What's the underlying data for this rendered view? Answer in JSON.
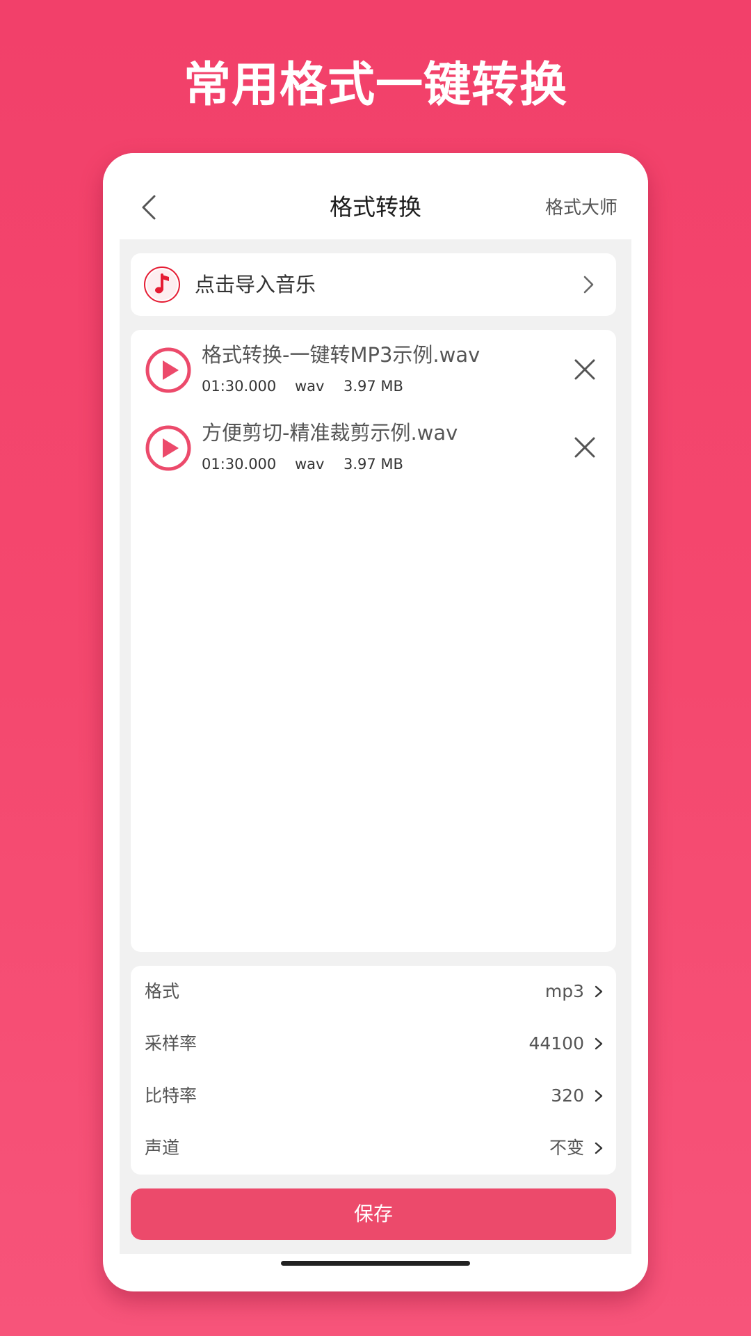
{
  "promo": {
    "title": "常用格式一键转换"
  },
  "navbar": {
    "title": "格式转换",
    "right_label": "格式大师"
  },
  "import": {
    "label": "点击导入音乐"
  },
  "files": [
    {
      "name": "格式转换-一键转MP3示例.wav",
      "duration": "01:30.000",
      "format": "wav",
      "size": "3.97 MB"
    },
    {
      "name": "方便剪切-精准裁剪示例.wav",
      "duration": "01:30.000",
      "format": "wav",
      "size": "3.97 MB"
    }
  ],
  "settings": [
    {
      "label": "格式",
      "value": "mp3"
    },
    {
      "label": "采样率",
      "value": "44100"
    },
    {
      "label": "比特率",
      "value": "320"
    },
    {
      "label": "声道",
      "value": "不变"
    }
  ],
  "actions": {
    "save_label": "保存"
  },
  "colors": {
    "accent": "#ec4a6b",
    "background": "#f2406a",
    "icon_red": "#e51c33"
  },
  "icons": {
    "back": "chevron-left-icon",
    "music": "music-note-icon",
    "play": "play-icon",
    "close": "close-icon",
    "chevron": "chevron-right-icon"
  }
}
